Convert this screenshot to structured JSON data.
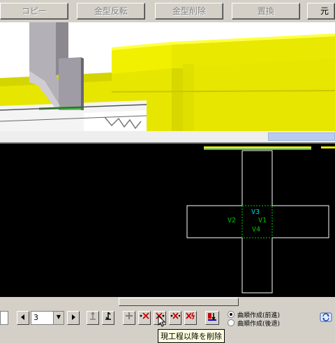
{
  "toolbar": {
    "copy_label": "コピー",
    "mold_flip_label": "金型反転",
    "mold_delete_label": "金型削除",
    "replace_label": "置換",
    "cut_label": "元"
  },
  "view2d": {
    "labels": [
      "V3",
      "V1",
      "V2",
      "V4"
    ]
  },
  "bottom": {
    "step_value": "3",
    "radio_forward": "曲順作成(前進)",
    "radio_backward": "曲順作成(後退)"
  },
  "tooltip": "現工程以降を削除",
  "colors": {
    "yellow": "#e8e800",
    "green_label": "#00cc00",
    "cyan_label": "#00d8d8"
  }
}
